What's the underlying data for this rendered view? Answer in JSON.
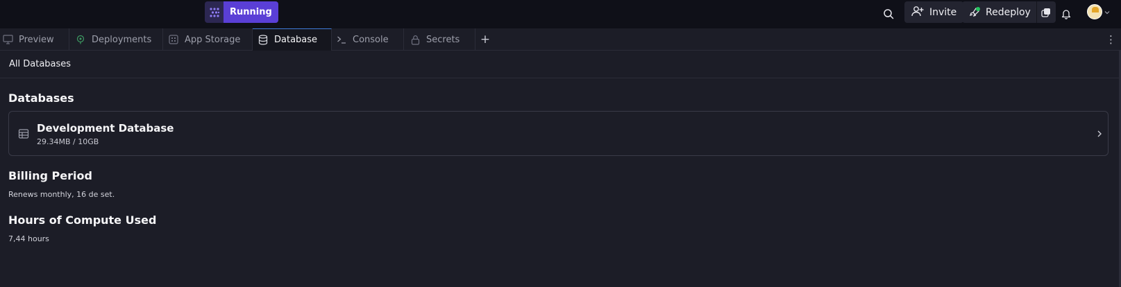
{
  "topbar": {
    "status_label": "Running",
    "invite_label": "Invite",
    "redeploy_label": "Redeploy",
    "icons": [
      "grid-dots-icon",
      "search-icon",
      "user-plus-icon",
      "rocket-icon",
      "copy-icon",
      "bell-icon",
      "chevron-down-icon"
    ]
  },
  "tabs": [
    {
      "label": "Preview",
      "icon": "monitor-icon"
    },
    {
      "label": "Deployments",
      "icon": "deploy-icon"
    },
    {
      "label": "App Storage",
      "icon": "storage-icon"
    },
    {
      "label": "Database",
      "icon": "database-icon"
    },
    {
      "label": "Console",
      "icon": "terminal-icon"
    },
    {
      "label": "Secrets",
      "icon": "lock-icon"
    }
  ],
  "active_tab": "Database",
  "breadcrumb": "All Databases",
  "databases": {
    "heading": "Databases",
    "items": [
      {
        "name": "Development Database",
        "usage": "29.34MB / 10GB"
      }
    ]
  },
  "billing": {
    "heading": "Billing Period",
    "text": "Renews monthly, 16 de set."
  },
  "compute": {
    "heading": "Hours of Compute Used",
    "text": "7,44 hours"
  },
  "colors": {
    "accent": "#5a3fd6",
    "active_tab_border": "#3f7bd9",
    "background": "#1c1d27",
    "topbar": "#0f1018",
    "status_dot": "#22c55e"
  }
}
